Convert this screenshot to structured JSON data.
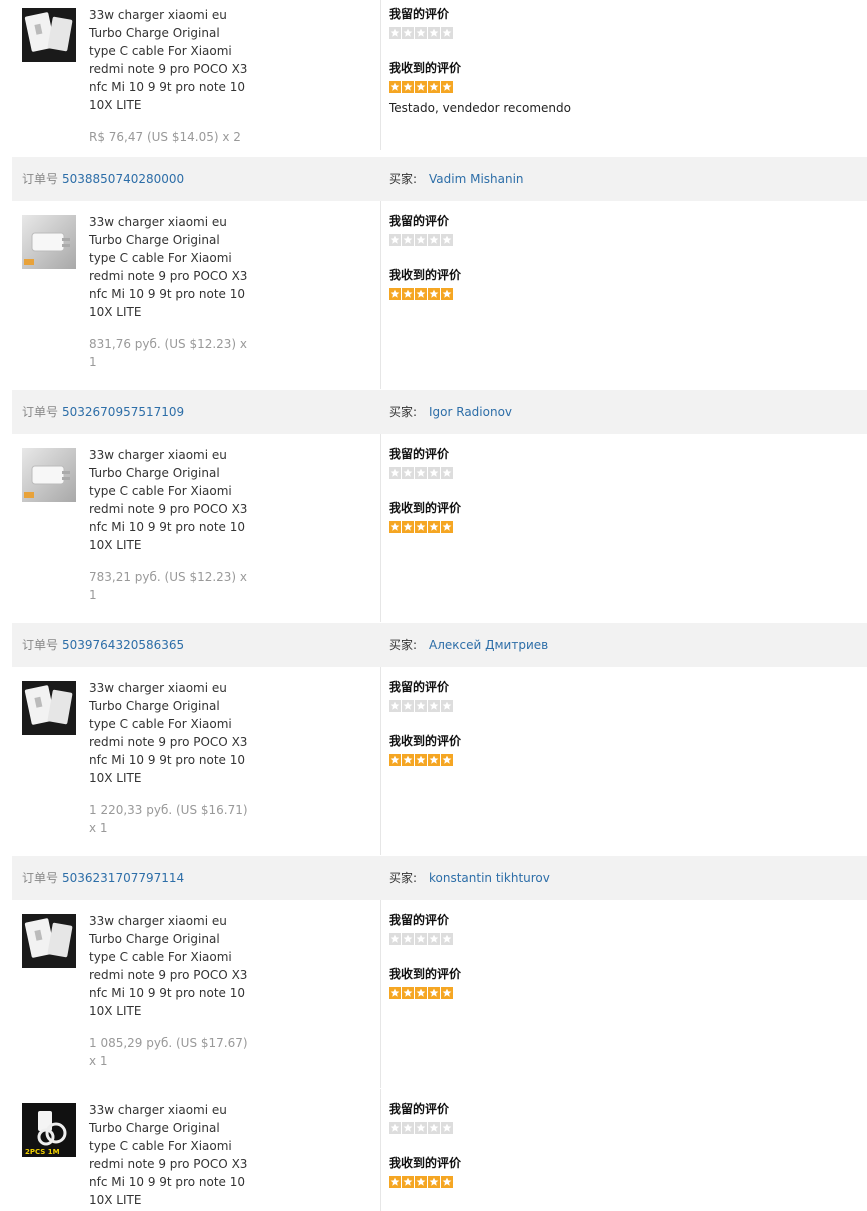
{
  "labels": {
    "order_prefix": "订单号",
    "buyer_prefix": "买家:",
    "my_review": "我留的评价",
    "received_review": "我收到的评价"
  },
  "colors": {
    "link": "#2d6ea8",
    "star_on": "#f5a623",
    "star_off": "#dddddd",
    "header_bg": "#f2f2f2"
  },
  "orders": [
    {
      "order_no": "",
      "buyer": "",
      "product_name": "33w charger xiaomi eu Turbo Charge Original type C cable For Xiaomi redmi note 9 pro POCO X3 nfc Mi 10 9 9t pro note 10 10X LITE",
      "price": "R$ 76,47 (US $14.05) x 2",
      "thumb_icon": "charger-box-icon",
      "my_rating": 0,
      "received_rating": 5,
      "received_comment": "Testado, vendedor recomendo"
    },
    {
      "order_no": "5038850740280000",
      "buyer": "Vadim Mishanin",
      "product_name": "33w charger xiaomi eu Turbo Charge Original type C cable For Xiaomi redmi note 9 pro POCO X3 nfc Mi 10 9 9t pro note 10 10X LITE",
      "price": "831,76 руб. (US $12.23) x 1",
      "thumb_icon": "charger-icon",
      "my_rating": 0,
      "received_rating": 5,
      "received_comment": ""
    },
    {
      "order_no": "5032670957517109",
      "buyer": "Igor Radionov",
      "product_name": "33w charger xiaomi eu Turbo Charge Original type C cable For Xiaomi redmi note 9 pro POCO X3 nfc Mi 10 9 9t pro note 10 10X LITE",
      "price": "783,21 руб. (US $12.23) x 1",
      "thumb_icon": "charger-icon",
      "my_rating": 0,
      "received_rating": 5,
      "received_comment": ""
    },
    {
      "order_no": "5039764320586365",
      "buyer": "Алексей Дмитриев",
      "product_name": "33w charger xiaomi eu Turbo Charge Original type C cable For Xiaomi redmi note 9 pro POCO X3 nfc Mi 10 9 9t pro note 10 10X LITE",
      "price": "1 220,33 руб. (US $16.71) x 1",
      "thumb_icon": "charger-box-icon",
      "my_rating": 0,
      "received_rating": 5,
      "received_comment": ""
    },
    {
      "order_no": "5036231707797114",
      "buyer": "konstantin tikhturov",
      "product_name": "33w charger xiaomi eu Turbo Charge Original type C cable For Xiaomi redmi note 9 pro POCO X3 nfc Mi 10 9 9t pro note 10 10X LITE",
      "price": "1 085,29 руб. (US $17.67) x 1",
      "thumb_icon": "charger-box-icon",
      "my_rating": 0,
      "received_rating": 5,
      "received_comment": ""
    },
    {
      "order_no": "",
      "buyer": "",
      "product_name": "33w charger xiaomi eu Turbo Charge Original type C cable For Xiaomi redmi note 9 pro POCO X3 nfc Mi 10 9 9t pro note 10 10X LITE",
      "price": "",
      "thumb_icon": "charger-cable-icon",
      "thumb_badge": "2PCS 1M",
      "my_rating": 0,
      "received_rating": 5,
      "received_comment": ""
    }
  ]
}
